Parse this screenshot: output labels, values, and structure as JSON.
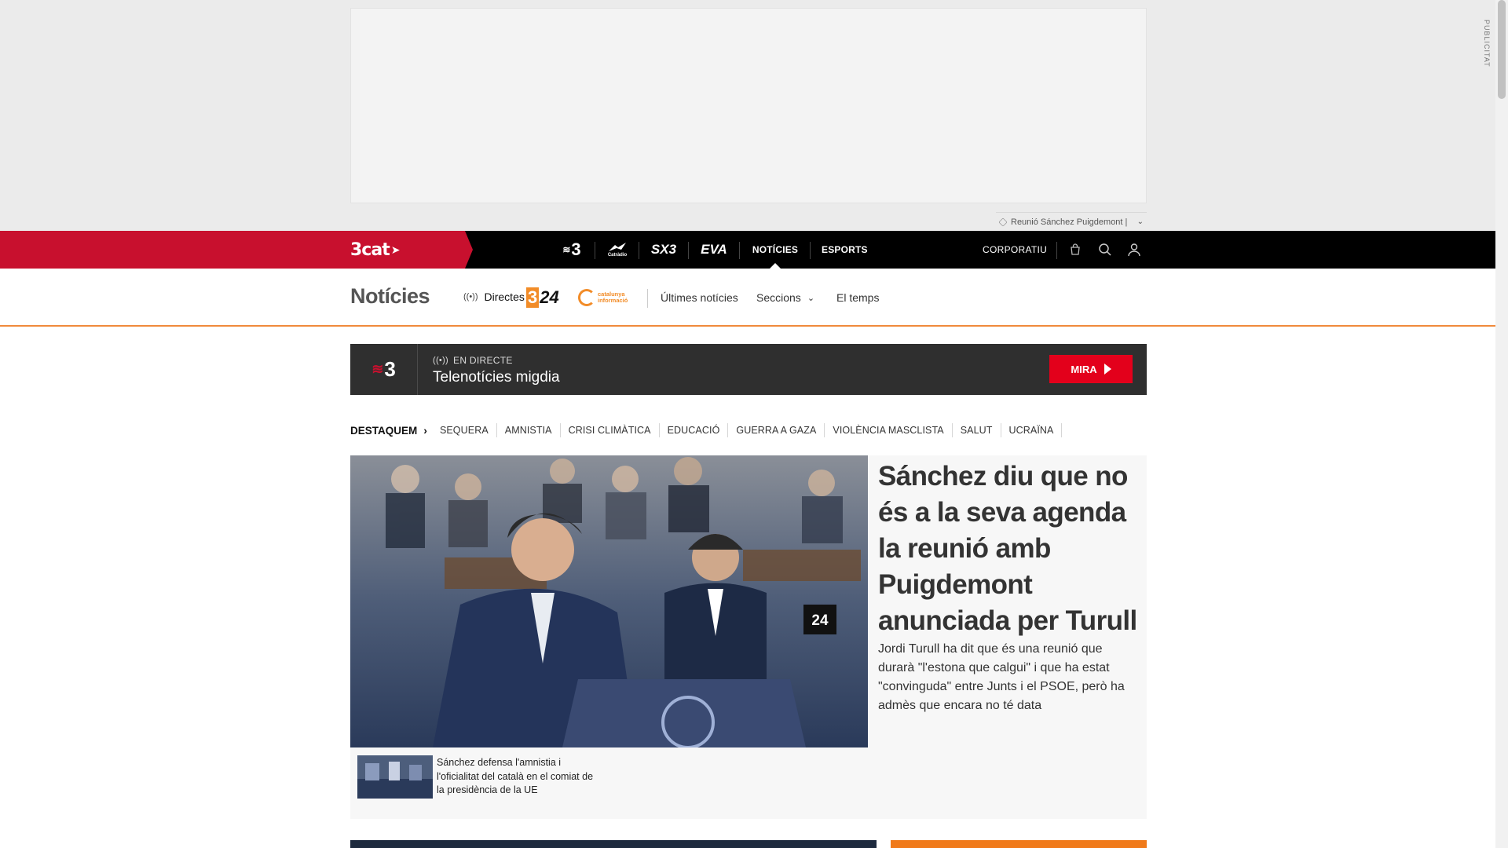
{
  "ad": {
    "label": "PUBLICITAT",
    "topic": "Reunió Sánchez Puigdemont |"
  },
  "nav": {
    "brand": "3cat",
    "channels": [
      "3",
      "Catràdio",
      "SX3",
      "EVA"
    ],
    "links": [
      "NOTÍCIES",
      "ESPORTS"
    ],
    "active": "NOTÍCIES",
    "corporatiu": "CORPORATIU",
    "colors": {
      "brand_red": "#c8102e",
      "bar": "#000000"
    }
  },
  "section": {
    "title": "Notícies",
    "directes": "Directes",
    "logo_324": "324",
    "logo_ci": "catalunya informació",
    "links": [
      "Últimes notícies",
      "Seccions",
      "El temps"
    ],
    "accent": "#f08a3c"
  },
  "live": {
    "channel": "3",
    "tag": "EN DIRECTE",
    "title": "Telenotícies migdia",
    "cta": "MIRA",
    "cta_color": "#e3001b"
  },
  "destaquem": {
    "label": "DESTAQUEM",
    "items": [
      "SEQUERA",
      "AMNISTIA",
      "CRISI CLIMÀTICA",
      "EDUCACIÓ",
      "GUERRA A GAZA",
      "VIOLÈNCIA MASCLISTA",
      "SALUT",
      "UCRAÏNA"
    ]
  },
  "article": {
    "headline": "Sánchez diu que no és a la seva agenda la reunió amb Puigdemont anunciada per Turull",
    "summary": "Jordi Turull ha dit que és una reunió que durarà \"l'estona que calgui\" i que ha estat \"convinguda\" entre Junts i el PSOE, però ha admès que encara no té data",
    "related": "Sánchez defensa l'amnistia i l'oficialitat del català en el comiat de la presidència de la UE",
    "image_number": "24"
  }
}
